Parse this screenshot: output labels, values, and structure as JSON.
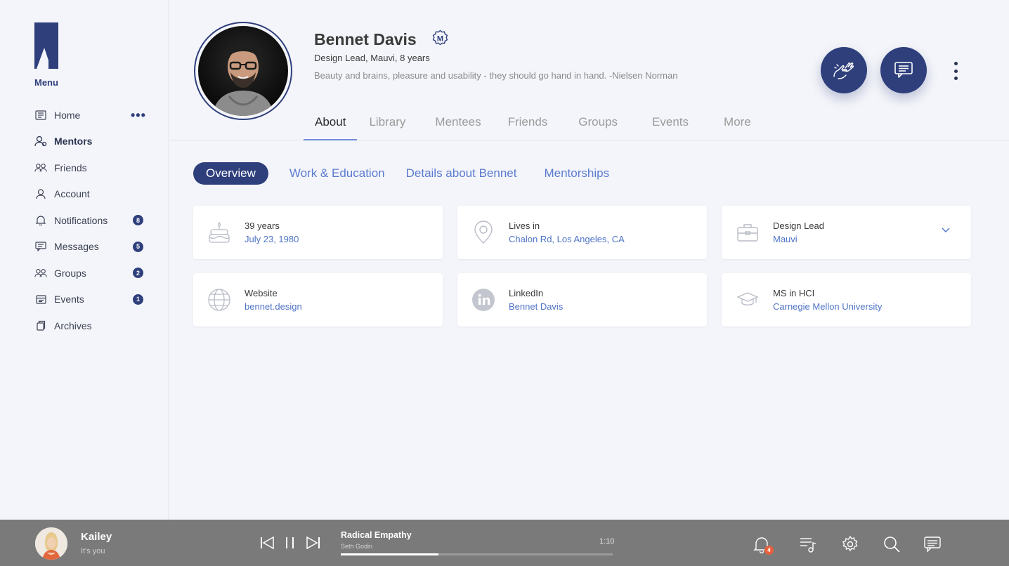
{
  "sidebar": {
    "menu_title": "Menu",
    "items": [
      {
        "label": "Home",
        "icon": "newspaper-icon"
      },
      {
        "label": "Mentors",
        "icon": "mentor-icon"
      },
      {
        "label": "Friends",
        "icon": "friends-icon"
      },
      {
        "label": "Account",
        "icon": "user-icon"
      },
      {
        "label": "Notifications",
        "icon": "bell-icon",
        "badge": "8"
      },
      {
        "label": "Messages",
        "icon": "message-icon",
        "badge": "5"
      },
      {
        "label": "Groups",
        "icon": "group-icon",
        "badge": "2"
      },
      {
        "label": "Events",
        "icon": "calendar-icon",
        "badge": "1"
      },
      {
        "label": "Archives",
        "icon": "archive-icon"
      }
    ],
    "more": "•••"
  },
  "profile": {
    "name": "Bennet Davis",
    "badge_letter": "M",
    "role": "Design Lead, Mauvi, 8 years",
    "quote": "Beauty and brains, pleasure and usability - they should go hand in hand. -Nielsen Norman"
  },
  "tabs": [
    "About",
    "Library",
    "Mentees",
    "Friends",
    "Groups",
    "Events",
    "More"
  ],
  "subtabs": [
    "Overview",
    "Work & Education",
    "Details about Bennet",
    "Mentorships"
  ],
  "cards": [
    {
      "label": "39 years",
      "value": "July 23, 1980",
      "icon": "birthday-cake-icon"
    },
    {
      "label": "Lives in",
      "value": "Chalon Rd, Los Angeles, CA",
      "icon": "location-pin-icon"
    },
    {
      "label": "Design Lead",
      "value": "Mauvi",
      "icon": "briefcase-icon"
    },
    {
      "label": "Website",
      "value": "bennet.design",
      "icon": "globe-icon"
    },
    {
      "label": "LinkedIn",
      "value": "Bennet Davis",
      "icon": "linkedin-icon"
    },
    {
      "label": "MS in HCI",
      "value": "Carnegie Mellon University",
      "icon": "graduation-cap-icon"
    }
  ],
  "player": {
    "user_name": "Kailey",
    "user_sub": "It's you",
    "track_title": "Radical Empathy",
    "track_author": "Seth Godin",
    "time": "1:10",
    "progress": 0.36,
    "notification_count": "4"
  },
  "colors": {
    "accent": "#2e3f7c",
    "link": "#4f74c8",
    "player_bg": "#7a7a7a",
    "notify": "#e8603c"
  }
}
